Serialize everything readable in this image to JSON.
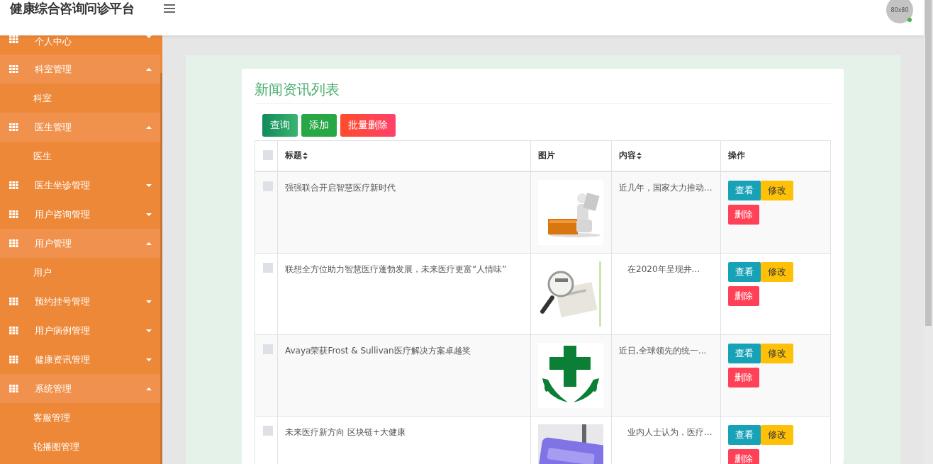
{
  "header": {
    "title": "健康综合咨询问诊平台",
    "avatar_text": "80x80",
    "online": true
  },
  "sidebar": {
    "items": [
      {
        "label": "个人中心",
        "expanded": false
      },
      {
        "label": "科室管理",
        "expanded": true,
        "children": [
          {
            "label": "科室"
          }
        ]
      },
      {
        "label": "医生管理",
        "expanded": true,
        "children": [
          {
            "label": "医生"
          }
        ]
      },
      {
        "label": "医生坐诊管理",
        "expanded": false
      },
      {
        "label": "用户咨询管理",
        "expanded": false
      },
      {
        "label": "用户管理",
        "expanded": true,
        "children": [
          {
            "label": "用户"
          }
        ]
      },
      {
        "label": "预约挂号管理",
        "expanded": false
      },
      {
        "label": "用户病例管理",
        "expanded": false
      },
      {
        "label": "健康资讯管理",
        "expanded": false
      },
      {
        "label": "系统管理",
        "expanded": true,
        "children": [
          {
            "label": "客服管理"
          },
          {
            "label": "轮播图管理"
          }
        ]
      }
    ]
  },
  "page": {
    "title": "新闻资讯列表",
    "toolbar": [
      {
        "label": "查询",
        "kind": "search"
      },
      {
        "label": "添加",
        "kind": "add"
      },
      {
        "label": "批量删除",
        "kind": "delete"
      }
    ],
    "table": {
      "all_checked": false,
      "columns": [
        {
          "label": "标题",
          "sortable": true
        },
        {
          "label": "图片",
          "sortable": false
        },
        {
          "label": "内容",
          "sortable": true
        },
        {
          "label": "操作",
          "sortable": false
        }
      ],
      "rows": [
        {
          "checked": false,
          "title": "强强联合开启智慧医疗新时代",
          "image": {
            "kind": "picture"
          },
          "content": "近几年，国家大力推动...",
          "actions": [
            {
              "label": "查看",
              "kind": "view"
            },
            {
              "label": "修改",
              "kind": "edit"
            },
            {
              "label": "删除",
              "kind": "delete"
            }
          ]
        },
        {
          "checked": false,
          "title": "联想全方位助力智慧医疗蓬勃发展，未来医疗更富“人情味”",
          "image": {
            "kind": "picture"
          },
          "content": "　在2020年呈现井...",
          "actions": [
            {
              "label": "查看",
              "kind": "view"
            },
            {
              "label": "修改",
              "kind": "edit"
            },
            {
              "label": "删除",
              "kind": "delete"
            }
          ]
        },
        {
          "checked": false,
          "title": "Avaya荣获Frost & Sullivan医疗解决方案卓越奖",
          "image": {
            "kind": "picture"
          },
          "content": "近日,全球领先的统一...",
          "actions": [
            {
              "label": "查看",
              "kind": "view"
            },
            {
              "label": "修改",
              "kind": "edit"
            },
            {
              "label": "删除",
              "kind": "delete"
            }
          ]
        },
        {
          "checked": false,
          "title": "未来医疗新方向 区块链+大健康",
          "image": {
            "kind": "picture"
          },
          "content": "　业内人士认为，医疗...",
          "actions": [
            {
              "label": "查看",
              "kind": "view"
            },
            {
              "label": "修改",
              "kind": "edit"
            },
            {
              "label": "删除",
              "kind": "delete"
            }
          ]
        }
      ]
    }
  }
}
